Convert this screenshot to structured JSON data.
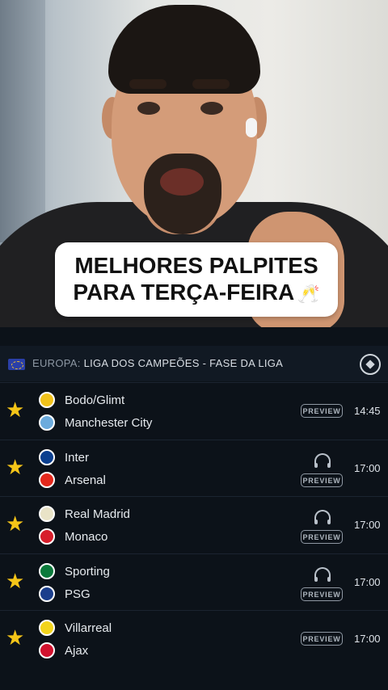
{
  "caption": {
    "line1": "MELHORES PALPITES",
    "line2": "PARA TERÇA-FEIRA",
    "emoji": "🥂"
  },
  "league": {
    "region": "EUROPA:",
    "name": "LIGA DOS CAMPEÕES - FASE DA LIGA",
    "flag_icon": "europe-flag-icon",
    "ball_icon": "football-icon"
  },
  "colors": {
    "star": "#f5c518",
    "background": "#0c1219",
    "text": "#e6eaee"
  },
  "matches": [
    {
      "home": "Bodo/Glimt",
      "away": "Manchester City",
      "badge": "PREVIEW",
      "time": "14:45",
      "audio": false,
      "home_color": "#f1c21b",
      "away_color": "#6cabdd"
    },
    {
      "home": "Inter",
      "away": "Arsenal",
      "badge": "PREVIEW",
      "time": "17:00",
      "audio": true,
      "home_color": "#0b3f8f",
      "away_color": "#e4281c"
    },
    {
      "home": "Real Madrid",
      "away": "Monaco",
      "badge": "PREVIEW",
      "time": "17:00",
      "audio": true,
      "home_color": "#e9e3c7",
      "away_color": "#d71e2b"
    },
    {
      "home": "Sporting",
      "away": "PSG",
      "badge": "PREVIEW",
      "time": "17:00",
      "audio": true,
      "home_color": "#0b7a3b",
      "away_color": "#1b3e8c"
    },
    {
      "home": "Villarreal",
      "away": "Ajax",
      "badge": "PREVIEW",
      "time": "17:00",
      "audio": false,
      "home_color": "#f2d41c",
      "away_color": "#d2122e"
    }
  ]
}
